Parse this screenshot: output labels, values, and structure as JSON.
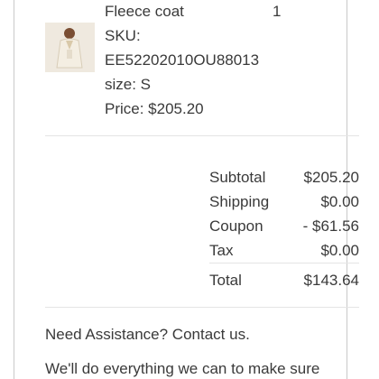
{
  "item": {
    "name": "Fleece coat",
    "quantity": "1",
    "sku_label": "SKU:",
    "sku_value": "EE52202010OU88013",
    "size": "size: S",
    "price": "Price: $205.20"
  },
  "summary": {
    "rows": [
      {
        "label": "Subtotal",
        "value": "$205.20"
      },
      {
        "label": "Shipping",
        "value": "$0.00"
      },
      {
        "label": "Coupon",
        "value": "- $61.56"
      },
      {
        "label": "Tax",
        "value": "$0.00"
      }
    ],
    "total_label": "Total",
    "total_value": "$143.64"
  },
  "assistance": {
    "heading": "Need Assistance? Contact us.",
    "body": "We'll do everything we can to make sure"
  }
}
